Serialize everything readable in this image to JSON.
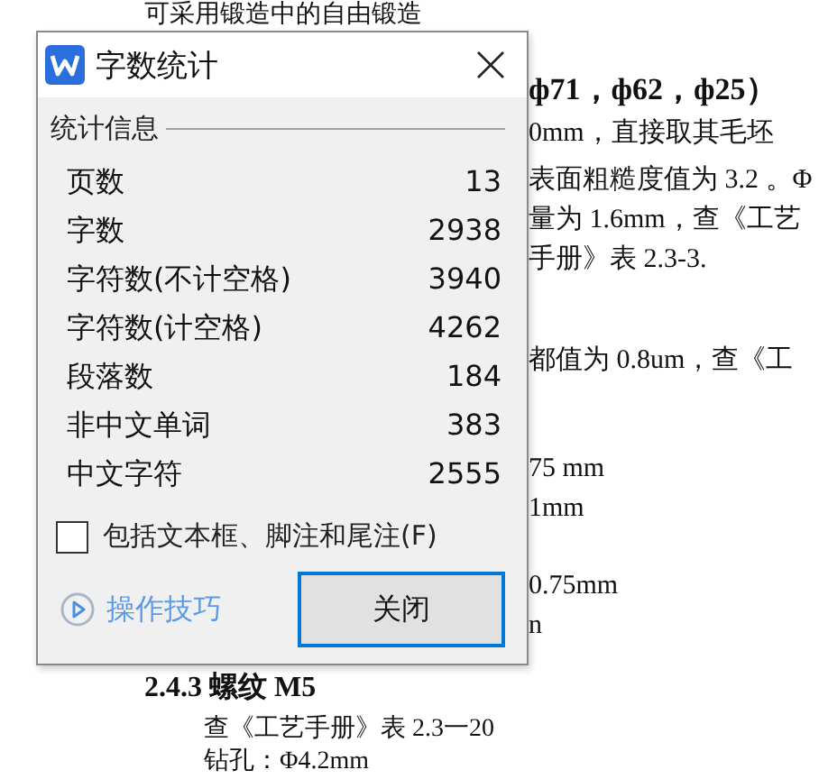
{
  "document": {
    "top_line": "可采用锻造中的自由锻造",
    "side_lines": [
      {
        "text": "ф71，ф62，ф25）",
        "kind": "heading"
      },
      {
        "text": "0mm，直接取其毛坯",
        "kind": "body"
      },
      {
        "text": "表面粗糙度值为 3.2 。Φ",
        "kind": "body"
      },
      {
        "text": "量为 1.6mm，查《工艺",
        "kind": "body"
      },
      {
        "text": "手册》表 2.3-3.",
        "kind": "body"
      },
      {
        "text": "都值为 0.8um，查《工",
        "kind": "body"
      },
      {
        "text": "75 mm",
        "kind": "body"
      },
      {
        "text": "1mm",
        "kind": "body"
      },
      {
        "text": "0.75mm",
        "kind": "body"
      },
      {
        "text": "n",
        "kind": "body"
      }
    ],
    "bottom_lines": [
      {
        "text": "2.4.3  螺纹 M5",
        "kind": "heading"
      },
      {
        "text": "查《工艺手册》表 2.3一20",
        "kind": "body"
      },
      {
        "text": "钻孔：Φ4.2mm",
        "kind": "body"
      }
    ]
  },
  "dialog": {
    "title": "字数统计",
    "group_label": "统计信息",
    "stats": [
      {
        "label": "页数",
        "value": "13"
      },
      {
        "label": "字数",
        "value": "2938"
      },
      {
        "label": "字符数(不计空格)",
        "value": "3940"
      },
      {
        "label": "字符数(计空格)",
        "value": "4262"
      },
      {
        "label": "段落数",
        "value": "184"
      },
      {
        "label": "非中文单词",
        "value": "383"
      },
      {
        "label": "中文字符",
        "value": "2555"
      }
    ],
    "checkbox": {
      "label": "包括文本框、脚注和尾注(F)",
      "checked": false
    },
    "tips_link": "操作技巧",
    "close_button": "关闭"
  }
}
